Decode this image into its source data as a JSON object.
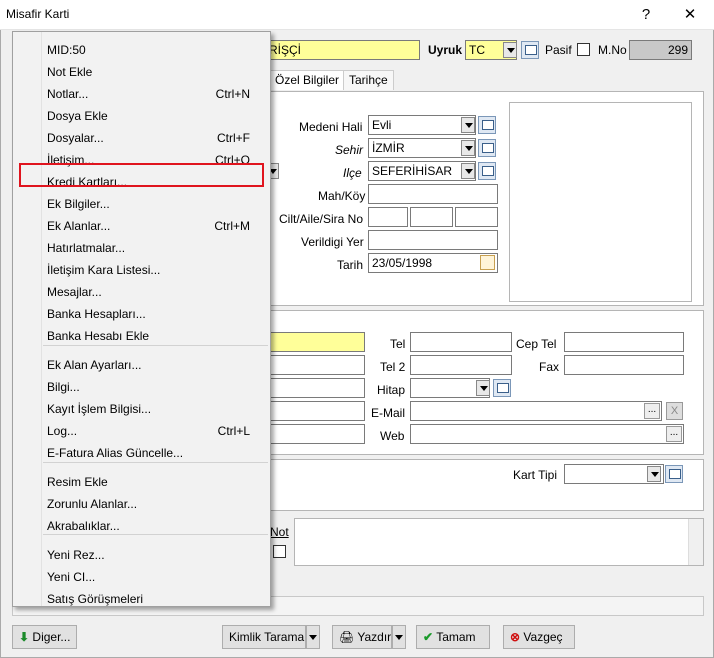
{
  "window": {
    "title": "Misafir Karti",
    "help": "?",
    "close": "✕"
  },
  "header": {
    "name_value": "RİŞÇİ",
    "uyruk_label": "Uyruk",
    "uyruk_value": "TC",
    "pasif_label": "Pasif",
    "mno_label": "M.No",
    "mno_value": "299"
  },
  "tabs": [
    "Özel Bilgiler",
    "Tarihçe"
  ],
  "ozel": {
    "medeni_label": "Medeni Hali",
    "medeni_value": "Evli",
    "sehir_label": "Sehir",
    "sehir_value": "İZMİR",
    "ilce_label": "Ilçe",
    "ilce_value": "SEFERİHİSAR",
    "mah_label": "Mah/Köy",
    "cilt_label": "Cilt/Aile/Sira No",
    "verildigi_label": "Verildigi Yer",
    "tarih_label": "Tarih",
    "tarih_value": "23/05/1998"
  },
  "contact": {
    "tel_label": "Tel",
    "cep_label": "Cep Tel",
    "tel2_label": "Tel 2",
    "fax_label": "Fax",
    "hitap_label": "Hitap",
    "email_label": "E-Mail",
    "web_label": "Web",
    "ellipsis": "...",
    "clear": "X"
  },
  "kart": {
    "kart_tipi_label": "Kart Tipi"
  },
  "not_label": "Not",
  "menu": {
    "items": [
      {
        "label": "MID:50",
        "shortcut": ""
      },
      {
        "label": "Not Ekle",
        "shortcut": ""
      },
      {
        "label": "Notlar...",
        "shortcut": "Ctrl+N"
      },
      {
        "label": "Dosya Ekle",
        "shortcut": ""
      },
      {
        "label": "Dosyalar...",
        "shortcut": "Ctrl+F"
      },
      {
        "label": "İletişim...",
        "shortcut": "Ctrl+O"
      },
      {
        "label": "Kredi Kartları...",
        "shortcut": ""
      },
      {
        "label": "Ek Bilgiler...",
        "shortcut": ""
      },
      {
        "label": "Ek Alanlar...",
        "shortcut": "Ctrl+M"
      },
      {
        "label": "Hatırlatmalar...",
        "shortcut": ""
      },
      {
        "label": "İletişim Kara Listesi...",
        "shortcut": ""
      },
      {
        "label": "Mesajlar...",
        "shortcut": ""
      },
      {
        "label": "Banka Hesapları...",
        "shortcut": ""
      },
      {
        "label": "Banka Hesabı Ekle",
        "shortcut": ""
      },
      {
        "label": "Ek Alan Ayarları...",
        "shortcut": ""
      },
      {
        "label": "Bilgi...",
        "shortcut": ""
      },
      {
        "label": "Kayıt İşlem Bilgisi...",
        "shortcut": ""
      },
      {
        "label": "Log...",
        "shortcut": "Ctrl+L"
      },
      {
        "label": "E-Fatura Alias Güncelle...",
        "shortcut": ""
      },
      {
        "label": "Resim Ekle",
        "shortcut": ""
      },
      {
        "label": "Zorunlu Alanlar...",
        "shortcut": ""
      },
      {
        "label": "Akrabalıklar...",
        "shortcut": ""
      },
      {
        "label": "Yeni Rez...",
        "shortcut": ""
      },
      {
        "label": "Yeni CI...",
        "shortcut": ""
      },
      {
        "label": "Satış Görüşmeleri",
        "shortcut": ""
      }
    ]
  },
  "footer": {
    "diger": "Diger...",
    "kimlik": "Kimlik Tarama",
    "yazdir": "Yazdır",
    "tamam": "Tamam",
    "vazgec": "Vazgeç"
  }
}
